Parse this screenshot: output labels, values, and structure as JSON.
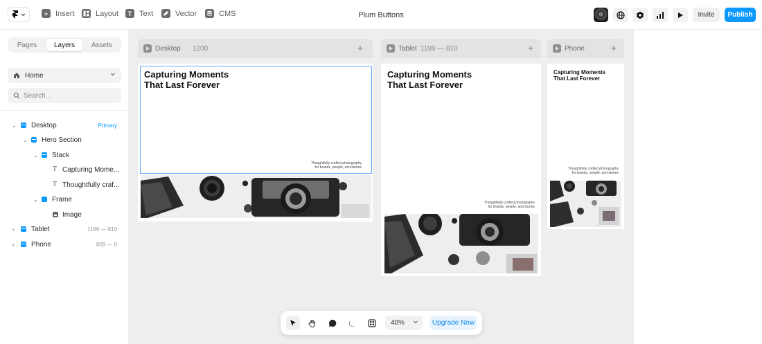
{
  "toolbar": {
    "insert": "Insert",
    "layout": "Layout",
    "text": "Text",
    "vector": "Vector",
    "cms": "CMS",
    "project_title": "Plum Buttons",
    "invite": "Invite",
    "publish": "Publish"
  },
  "left_panel": {
    "tabs": [
      "Pages",
      "Layers",
      "Assets"
    ],
    "active_tab": "Layers",
    "page": "Home",
    "search_placeholder": "Search...",
    "layers": [
      {
        "name": "Desktop",
        "meta": "Primary"
      },
      {
        "name": "Hero Section",
        "meta": ""
      },
      {
        "name": "Stack",
        "meta": ""
      },
      {
        "name": "Capturing Mome...",
        "meta": ""
      },
      {
        "name": "Thoughtfully craf...",
        "meta": ""
      },
      {
        "name": "Frame",
        "meta": ""
      },
      {
        "name": "Image",
        "meta": ""
      },
      {
        "name": "Tablet",
        "meta": "1199 — 810"
      },
      {
        "name": "Phone",
        "meta": "809 — 0"
      }
    ]
  },
  "breakpoints": {
    "desktop": {
      "name": "Desktop",
      "size": "1200"
    },
    "tablet": {
      "name": "Tablet",
      "size": "1199 — 810"
    },
    "phone": {
      "name": "Phone",
      "size": ""
    }
  },
  "hero": {
    "title_line1": "Capturing Moments",
    "title_line2": "That Last Forever",
    "subtitle_line1": "Thoughtfully crafted photography",
    "subtitle_line2": "for brands, people, and stories"
  },
  "bottom_bar": {
    "zoom": "40%",
    "upgrade": "Upgrade Now"
  },
  "colors": {
    "accent": "#0a99ff",
    "canvas": "#efeeef"
  },
  "icons": {
    "select": "cursor-icon",
    "hand": "hand-icon",
    "comment": "comment-icon",
    "theme": "moon-icon",
    "components": "grid-icon"
  }
}
